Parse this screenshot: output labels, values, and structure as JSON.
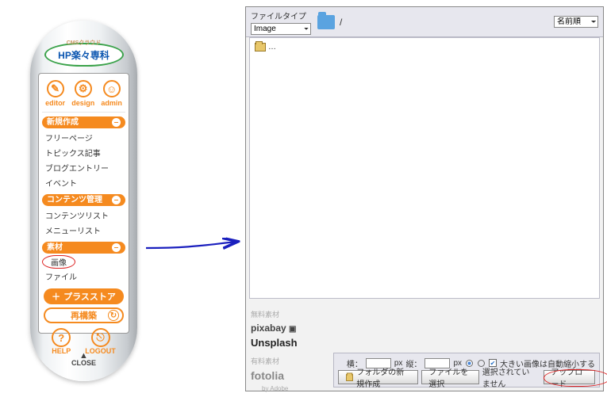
{
  "pill": {
    "logo_sub": "CMSクラウド",
    "logo_main": "HP楽々専科",
    "tabs": [
      {
        "icon": "✎",
        "label": "editor"
      },
      {
        "icon": "⚙",
        "label": "design"
      },
      {
        "icon": "☺",
        "label": "admin"
      }
    ],
    "sections": [
      {
        "title": "新規作成",
        "items": [
          "フリーページ",
          "トピックス記事",
          "ブログエントリー",
          "イベント"
        ]
      },
      {
        "title": "コンテンツ管理",
        "items": [
          "コンテンツリスト",
          "メニューリスト"
        ]
      },
      {
        "title": "素材",
        "items": [
          "画像",
          "ファイル"
        ],
        "circled_index": 0
      }
    ],
    "plus_store": "プラスストア",
    "rebuild": "再構築",
    "help": "HELP",
    "logout": "LOGOUT",
    "close": "CLOSE"
  },
  "dialog": {
    "file_type_label": "ファイルタイプ",
    "file_type_value": "Image",
    "path": "/",
    "name_select": "名前順",
    "folder_item": "…",
    "sources": {
      "free_hd": "無料素材",
      "pixabay": "pixabay",
      "unsplash": "Unsplash",
      "paid_hd": "有料素材",
      "fotolia": "fotolia",
      "adobe": "by Adobe"
    },
    "toolbar": {
      "width_label": "横：",
      "height_label": "縦：",
      "px": "px",
      "resize_label": "大きい画像は自動縮小する",
      "new_folder": "フォルダの新規作成",
      "choose_file": "ファイルを選択",
      "no_file": "選択されていません",
      "upload": "アップロード"
    }
  }
}
